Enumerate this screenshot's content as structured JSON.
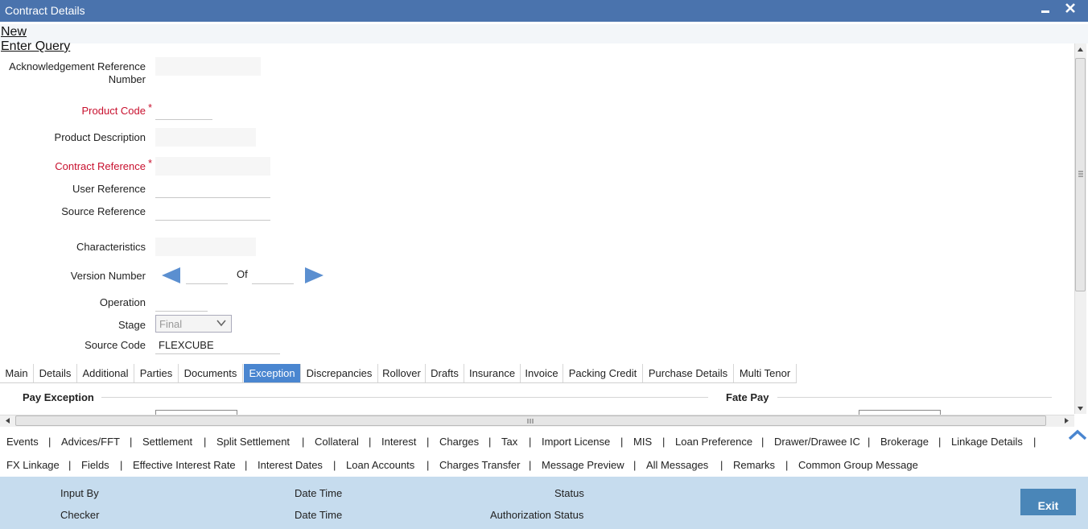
{
  "window": {
    "title": "Contract Details",
    "minimize": "▬",
    "close": "✕"
  },
  "menu": {
    "new": "New",
    "enter_query": "Enter Query"
  },
  "form": {
    "ack_ref_label_1": "Acknowledgement Reference",
    "ack_ref_label_2": "Number",
    "product_code_label": "Product Code",
    "product_desc_label": "Product Description",
    "contract_ref_label": "Contract Reference",
    "user_ref_label": "User Reference",
    "source_ref_label": "Source Reference",
    "characteristics_label": "Characteristics",
    "version_label": "Version Number",
    "of_label": "Of",
    "operation_label": "Operation",
    "stage_label": "Stage",
    "stage_value": "Final",
    "source_code_label": "Source Code",
    "source_code_value": "FLEXCUBE",
    "required_mark": "*"
  },
  "tabs": [
    "Main",
    "Details",
    "Additional",
    "Parties",
    "Documents",
    "Exception",
    "Discrepancies",
    "Rollover",
    "Drafts",
    "Insurance",
    "Invoice",
    "Packing Credit",
    "Purchase Details",
    "Multi Tenor"
  ],
  "active_tab": "Exception",
  "sections": {
    "pay_exception": "Pay Exception",
    "fate_pay": "Fate Pay"
  },
  "nav_row1": [
    "Events",
    "Advices/FFT",
    "Settlement",
    "Split Settlement",
    "Collateral",
    "Interest",
    "Charges",
    "Tax",
    "Import License",
    "MIS",
    "Loan Preference",
    "Drawer/Drawee IC",
    "Brokerage",
    "Linkage Details"
  ],
  "nav_row2": [
    "FX Linkage",
    "Fields",
    "Effective Interest Rate",
    "Interest Dates",
    "Loan Accounts",
    "Charges Transfer",
    "Message Preview",
    "All Messages",
    "Remarks",
    "Common Group Message"
  ],
  "nav_sep": "|",
  "footer": {
    "input_by": "Input By",
    "checker": "Checker",
    "date_time_1": "Date Time",
    "date_time_2": "Date Time",
    "status": "Status",
    "auth_status": "Authorization Status",
    "exit": "Exit"
  },
  "colors": {
    "titlebar": "#4a73ad",
    "active_tab": "#4a86d0",
    "footer": "#c6dcee",
    "required": "#c8102e",
    "exit_button": "#4a86b8"
  }
}
